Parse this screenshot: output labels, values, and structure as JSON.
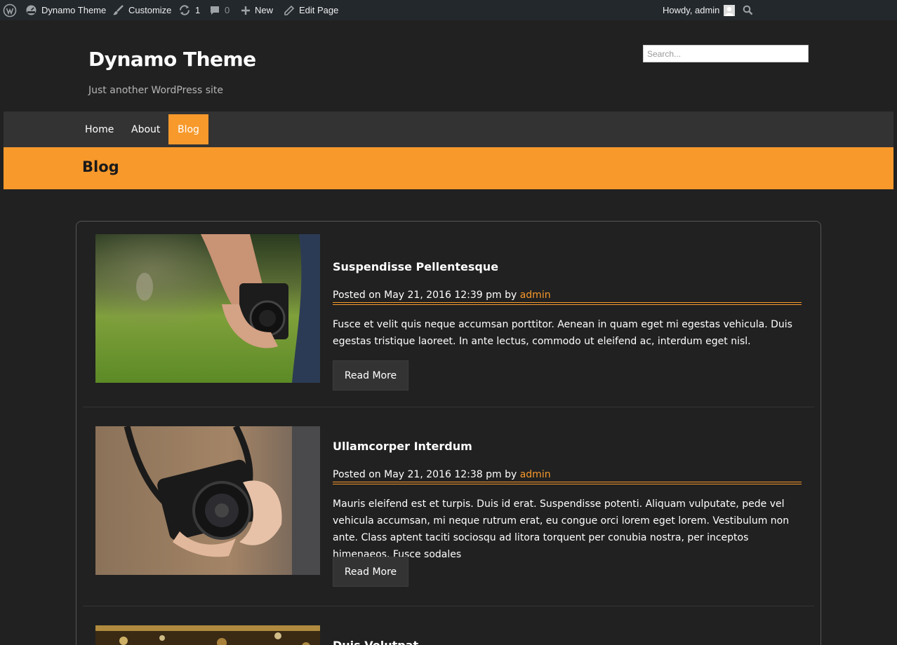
{
  "adminbar": {
    "site_name": "Dynamo Theme",
    "customize": "Customize",
    "updates_count": "1",
    "comments_count": "0",
    "new_label": "New",
    "edit_page": "Edit Page",
    "howdy": "Howdy, admin"
  },
  "site": {
    "title": "Dynamo Theme",
    "description": "Just another WordPress site"
  },
  "search": {
    "placeholder": "Search..."
  },
  "nav": {
    "items": [
      {
        "label": "Home"
      },
      {
        "label": "About"
      },
      {
        "label": "Blog"
      }
    ],
    "active": "Blog"
  },
  "page": {
    "title": "Blog"
  },
  "posts": [
    {
      "title": "Suspendisse Pellentesque",
      "meta_prefix": "Posted on May 21, 2016 12:39 pm by ",
      "author": "admin",
      "excerpt": "Fusce et velit quis neque accumsan porttitor. Aenean in quam eget mi egestas vehicula. Duis egestas tristique laoreet. In ante lectus, commodo ut eleifend ac, interdum eget nisl.",
      "read_more": "Read More"
    },
    {
      "title": "Ullamcorper Interdum",
      "meta_prefix": "Posted on May 21, 2016 12:38 pm by ",
      "author": "admin",
      "excerpt": "Mauris eleifend est et turpis. Duis id erat. Suspendisse potenti. Aliquam vulputate, pede vel vehicula accumsan, mi neque rutrum erat, eu congue orci lorem eget lorem. Vestibulum non ante. Class aptent taciti sociosqu ad litora torquent per conubia nostra, per inceptos himenaeos. Fusce sodales",
      "read_more": "Read More"
    },
    {
      "title": "Duis Volutpat"
    }
  ],
  "colors": {
    "accent": "#f7992b",
    "background": "#212121",
    "nav_bg": "#333333",
    "adminbar_bg": "#23282d"
  }
}
